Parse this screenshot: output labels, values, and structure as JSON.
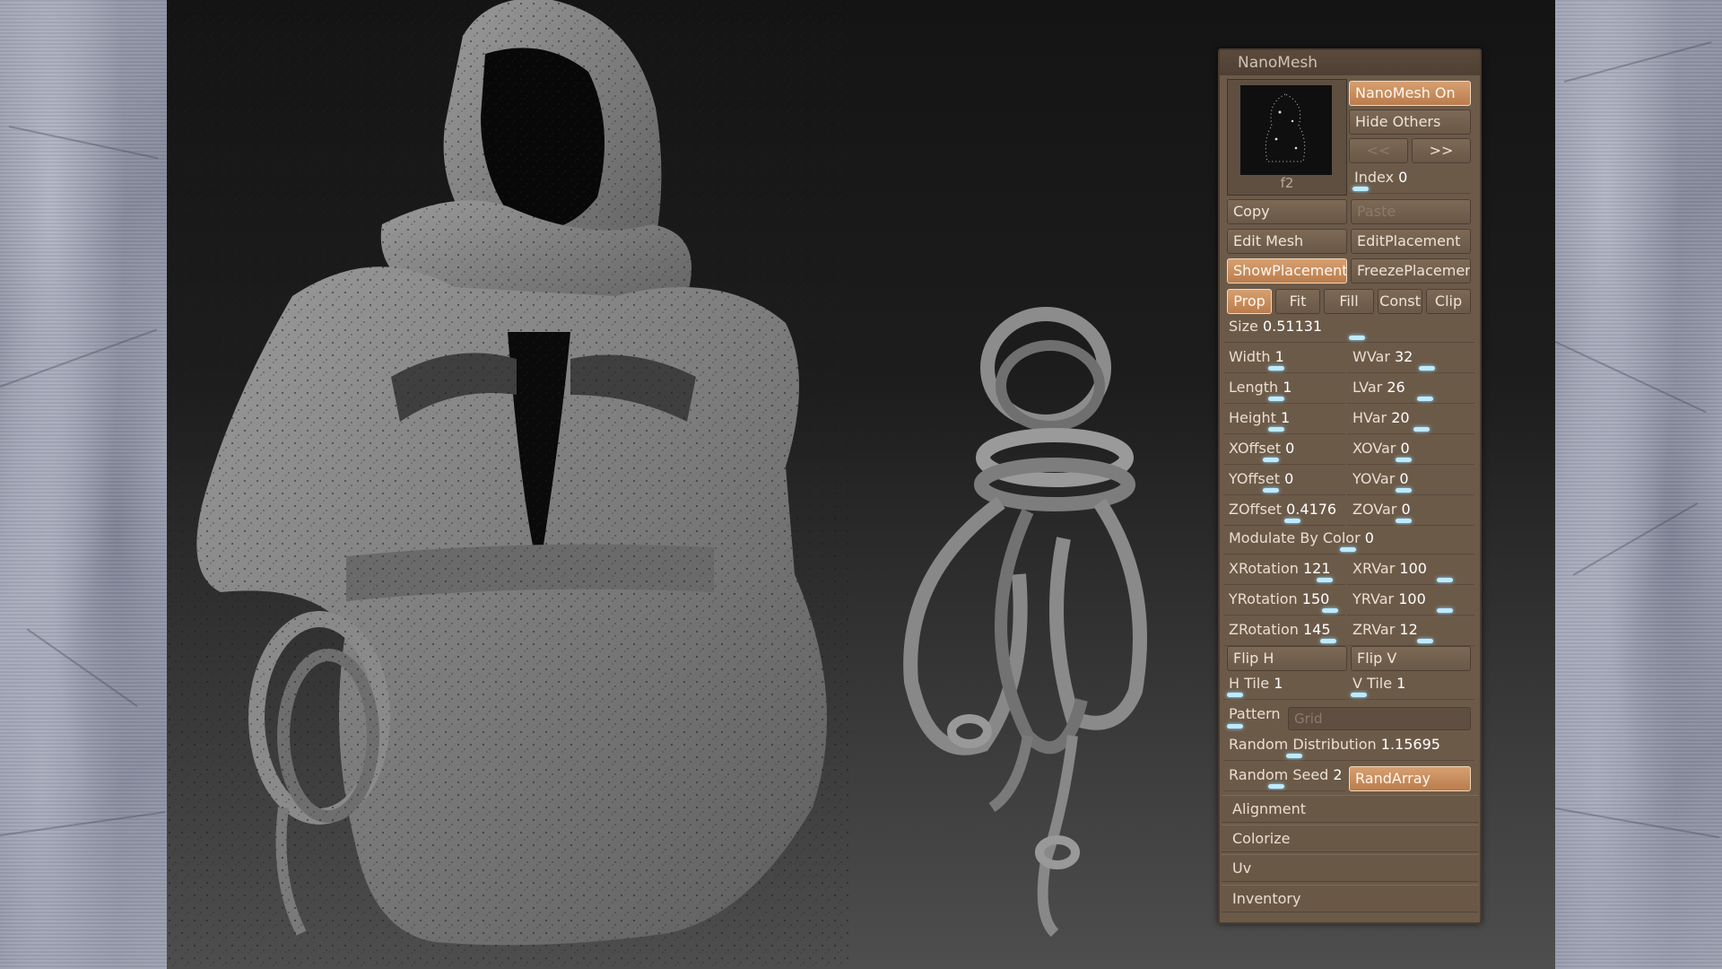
{
  "panel": {
    "title": "NanoMesh",
    "thumbnail_label": "f2",
    "nanomesh_on": "NanoMesh On",
    "hide_others": "Hide Others",
    "prev": "<<",
    "next": ">>",
    "index_label": "Index",
    "index_value": "0",
    "copy": "Copy",
    "paste": "Paste",
    "edit_mesh": "Edit Mesh",
    "edit_placement": "EditPlacement",
    "show_placement": "ShowPlacement",
    "freeze_placement": "FreezePlacemer",
    "modes": [
      "Prop",
      "Fit",
      "Fill",
      "Const",
      "Clip"
    ],
    "size": {
      "label": "Size",
      "value": "0.51131"
    },
    "sliders_left": [
      {
        "label": "Width",
        "value": "1"
      },
      {
        "label": "Length",
        "value": "1"
      },
      {
        "label": "Height",
        "value": "1"
      },
      {
        "label": "XOffset",
        "value": "0"
      },
      {
        "label": "YOffset",
        "value": "0"
      },
      {
        "label": "ZOffset",
        "value": "0.4176"
      }
    ],
    "sliders_right": [
      {
        "label": "WVar",
        "value": "32"
      },
      {
        "label": "LVar",
        "value": "26"
      },
      {
        "label": "HVar",
        "value": "20"
      },
      {
        "label": "XOVar",
        "value": "0"
      },
      {
        "label": "YOVar",
        "value": "0"
      },
      {
        "label": "ZOVar",
        "value": "0"
      }
    ],
    "modulate": {
      "label": "Modulate By Color",
      "value": "0"
    },
    "rot_left": [
      {
        "label": "XRotation",
        "value": "121"
      },
      {
        "label": "YRotation",
        "value": "150"
      },
      {
        "label": "ZRotation",
        "value": "145"
      }
    ],
    "rot_right": [
      {
        "label": "XRVar",
        "value": "100"
      },
      {
        "label": "YRVar",
        "value": "100"
      },
      {
        "label": "ZRVar",
        "value": "12"
      }
    ],
    "flip_h": "Flip H",
    "flip_v": "Flip V",
    "h_tile": {
      "label": "H Tile",
      "value": "1"
    },
    "v_tile": {
      "label": "V Tile",
      "value": "1"
    },
    "pattern": {
      "label": "Pattern",
      "value": "Grid"
    },
    "random_distribution": {
      "label": "Random Distribution",
      "value": "1.15695"
    },
    "random_seed": {
      "label": "Random Seed",
      "value": "2"
    },
    "rand_array": "RandArray",
    "sections": [
      "Alignment",
      "Colorize",
      "Uv",
      "Inventory"
    ]
  }
}
